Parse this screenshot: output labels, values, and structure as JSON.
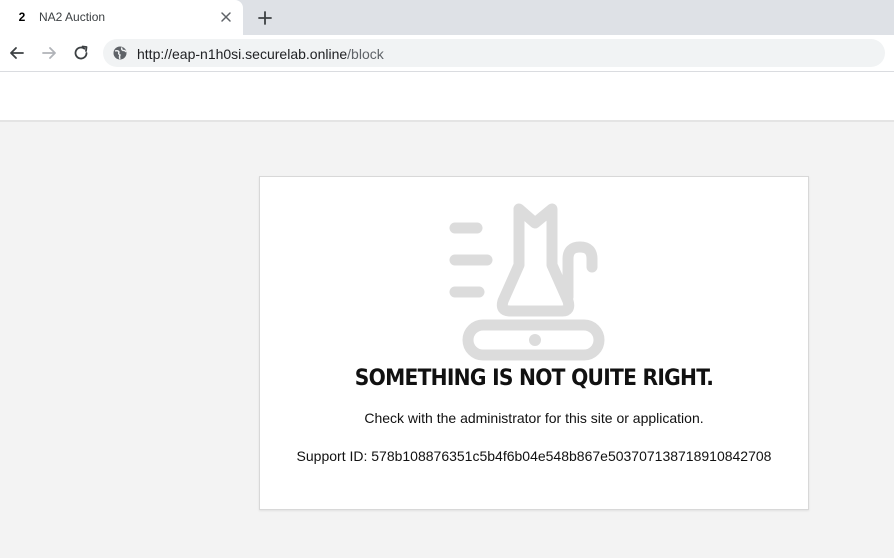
{
  "browser": {
    "tab": {
      "favicon_text": "2",
      "title": "NA2 Auction"
    },
    "address": {
      "host": "http://eap-n1h0si.securelab.online",
      "path": "/block"
    },
    "icons": [
      "back-arrow-icon",
      "forward-arrow-icon",
      "reload-icon",
      "globe-icon",
      "close-icon",
      "plus-icon"
    ]
  },
  "block_page": {
    "headline": "SOMETHING IS NOT QUITE RIGHT.",
    "message": "Check with the administrator for this site or application.",
    "support_id": "Support ID: 578b108876351c5b4f6b04e548b867e503707138718910842708",
    "illustration_icon": "speeding-cat-icon",
    "colors": {
      "illustration": "#dcdcdc",
      "background": "#f3f3f3",
      "card": "#ffffff"
    }
  }
}
